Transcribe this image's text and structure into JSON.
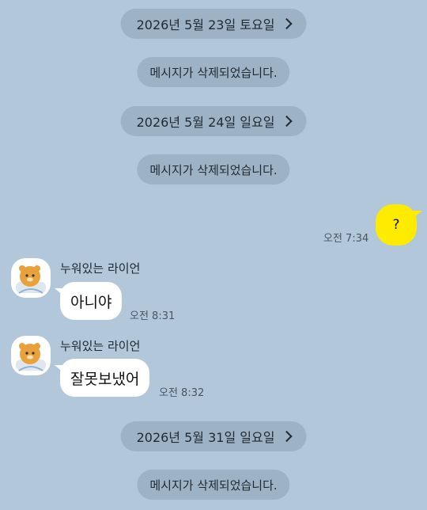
{
  "chat": {
    "date_1": "2026년 5월 23일 토요일",
    "deleted_1": "메시지가 삭제되었습니다.",
    "date_2": "2026년 5월 24일 일요일",
    "deleted_2": "메시지가 삭제되었습니다.",
    "my_message": {
      "text": "?",
      "time": "오전 7:34"
    },
    "received_1": {
      "sender": "누워있는 라이언",
      "text": "아니야",
      "time": "오전 8:31"
    },
    "received_2": {
      "sender": "누워있는 라이언",
      "text": "잘못보냈어",
      "time": "오전 8:32"
    },
    "date_3": "2026년 5월 31일 일요일",
    "deleted_3": "메시지가 삭제되었습니다."
  },
  "colors": {
    "background": "#b2c7d9",
    "my_bubble": "#ffeb00",
    "other_bubble": "#ffffff"
  },
  "icons": {
    "date_arrow": "chevron-right-icon",
    "avatar": "ryan-avatar-icon"
  }
}
